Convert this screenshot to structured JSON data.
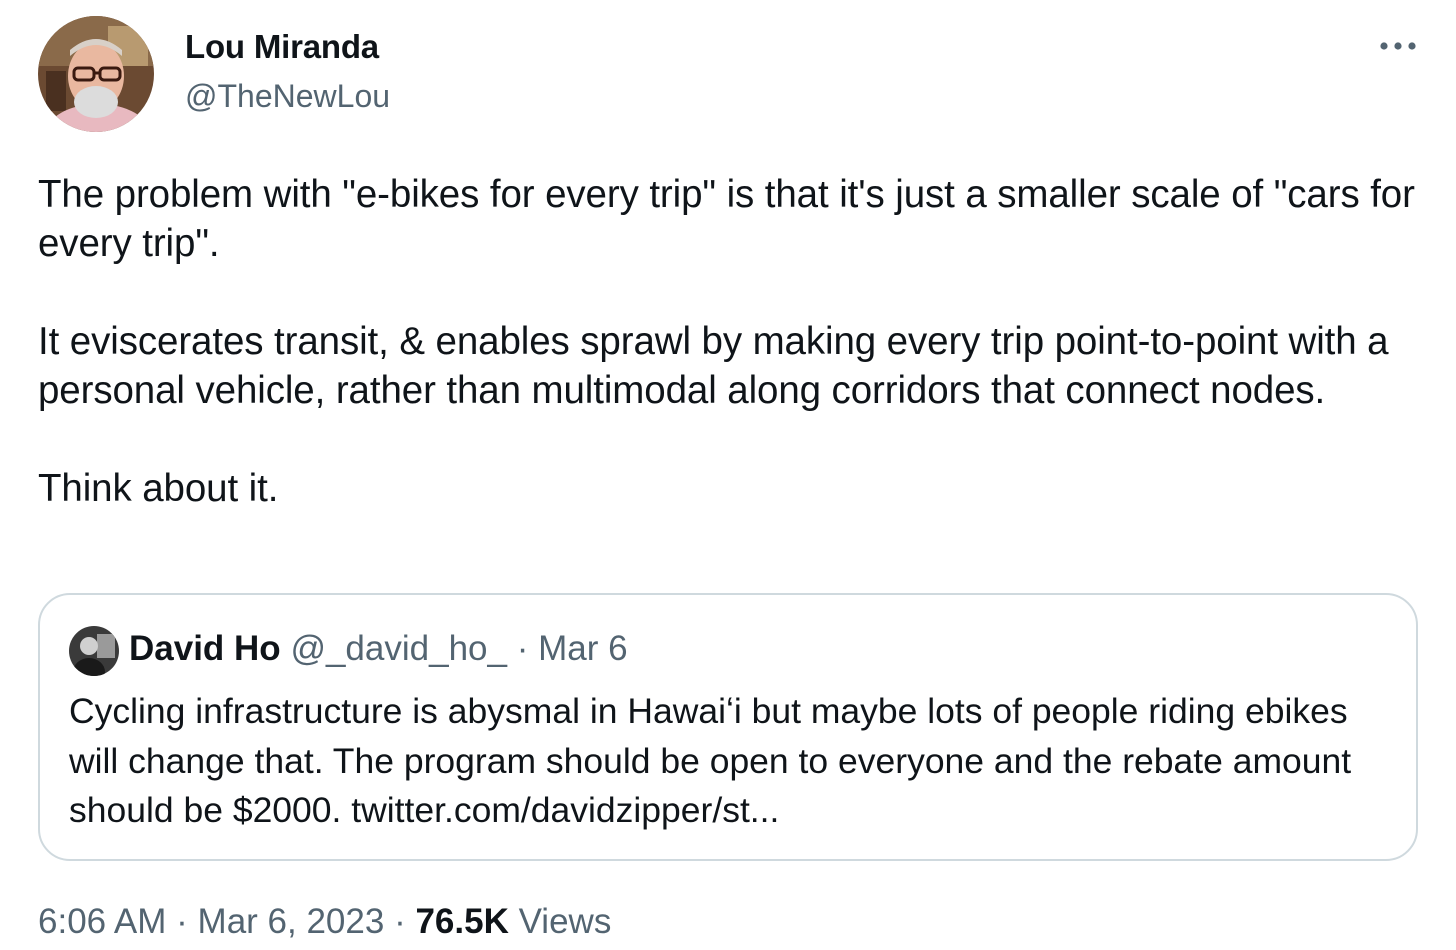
{
  "author": {
    "name": "Lou Miranda",
    "handle": "@TheNewLou"
  },
  "tweet": {
    "paragraphs": [
      "The problem with \"e-bikes for every trip\" is that it's just a smaller scale of \"cars for every trip\".",
      "It eviscerates transit, & enables sprawl by making every trip point-to-point with a personal vehicle, rather than multimodal along corridors that connect nodes.",
      "Think about it."
    ]
  },
  "quoted_tweet": {
    "name": "David Ho",
    "handle": "@_david_ho_",
    "separator": "·",
    "date": "Mar 6",
    "text": "Cycling infrastructure is abysmal in Hawaiʻi but maybe lots of people riding ebikes will change that. The program should be open to everyone and the rebate amount should be $2000. twitter.com/davidzipper/st..."
  },
  "meta": {
    "time": "6:06 AM",
    "separator": "·",
    "date": "Mar 6, 2023",
    "views_count": "76.5K",
    "views_label": "Views"
  },
  "icons": {
    "more": "more-options-icon"
  },
  "colors": {
    "text_primary": "#0f1419",
    "text_secondary": "#536471",
    "border": "#cfd9de"
  }
}
